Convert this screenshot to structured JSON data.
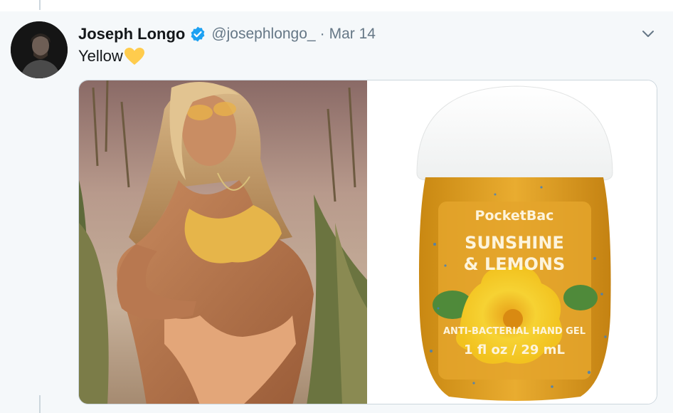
{
  "tweet": {
    "display_name": "Joseph Longo",
    "handle": "@josephlongo_",
    "separator": "·",
    "date": "Mar 14",
    "text": "Yellow"
  },
  "icons": {
    "verified": "verified-badge-icon",
    "caret": "chevron-down-icon",
    "emoji": "yellow-heart-emoji"
  },
  "media": {
    "product": {
      "brand": "PocketBac",
      "scent_line1": "SUNSHINE",
      "scent_line2": "& LEMONS",
      "type": "ANTI-BACTERIAL HAND GEL",
      "size": "1 fl oz / 29 mL"
    }
  },
  "colors": {
    "verified": "#1da1f2",
    "heart": "#ffcc4d",
    "gel": "#e0a11c",
    "secondary_text": "#657786"
  }
}
